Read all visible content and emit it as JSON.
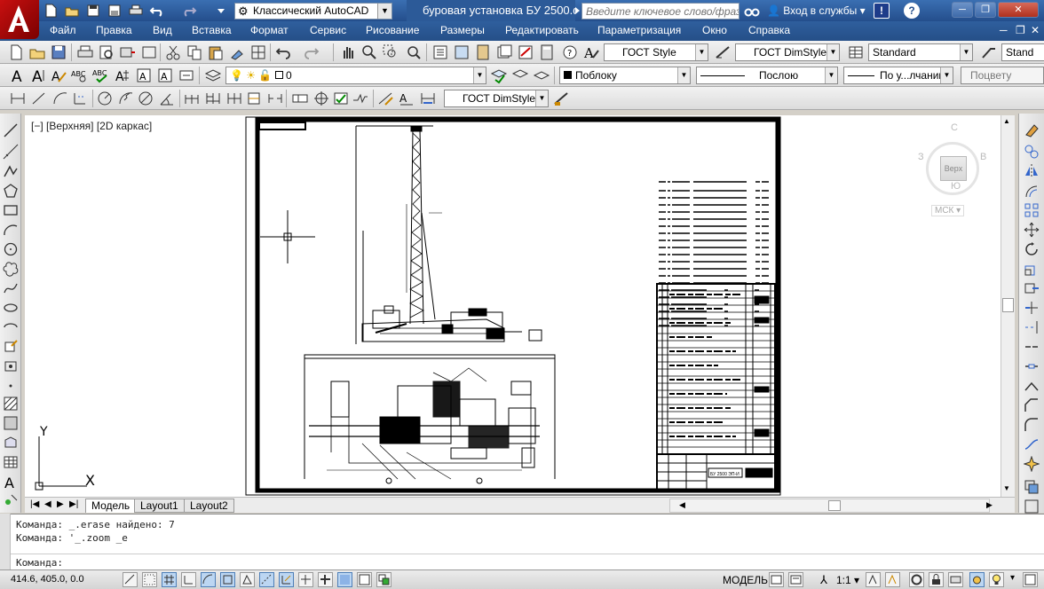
{
  "title_bar": {
    "workspace": "Классический AutoCAD",
    "document_title": "буровая установка БУ 2500.d...",
    "search_placeholder": "Введите ключевое слово/фразу",
    "sign_in": "Вход в службы",
    "help_label": "?",
    "exchange_label": "!"
  },
  "menu": {
    "items": [
      "Файл",
      "Правка",
      "Вид",
      "Вставка",
      "Формат",
      "Сервис",
      "Рисование",
      "Размеры",
      "Редактировать",
      "Параметризация",
      "Окно",
      "Справка"
    ]
  },
  "styles_toolbar": {
    "text_style": "ГОСТ Style",
    "dim_style": "ГОСТ DimStyle",
    "table_style": "Standard",
    "multileader_style": "Stand"
  },
  "layers_toolbar": {
    "layer_name": "0",
    "color": "Поблоку",
    "linetype": "Послою",
    "lineweight": "По у...лчаник",
    "plot_style": "Поцвету"
  },
  "dim_toolbar": {
    "dim_style": "ГОСТ DimStyle"
  },
  "viewport": {
    "label": "[−] [Верхняя] [2D каркас]",
    "viewcube_top": "Верх",
    "compass_n": "С",
    "compass_s": "Ю",
    "compass_w": "З",
    "compass_e": "В",
    "ucs": "МСК",
    "axis_x": "X",
    "axis_y": "Y"
  },
  "drawing": {
    "title_block_text": "БУ 2500 ЭП-И"
  },
  "layout_tabs": [
    "Модель",
    "Layout1",
    "Layout2"
  ],
  "command": {
    "history": [
      "Команда: _.erase найдено: 7",
      "Команда: '_.zoom _e"
    ],
    "prompt": "Команда:"
  },
  "status": {
    "coordinates": "414.6, 405.0, 0.0",
    "space": "МОДЕЛЬ",
    "annotation_scale": "1:1"
  },
  "colors": {
    "titlebar": "#2c5a98",
    "menubar": "#254f88",
    "canvas": "#ffffff",
    "logo": "#c81010"
  }
}
